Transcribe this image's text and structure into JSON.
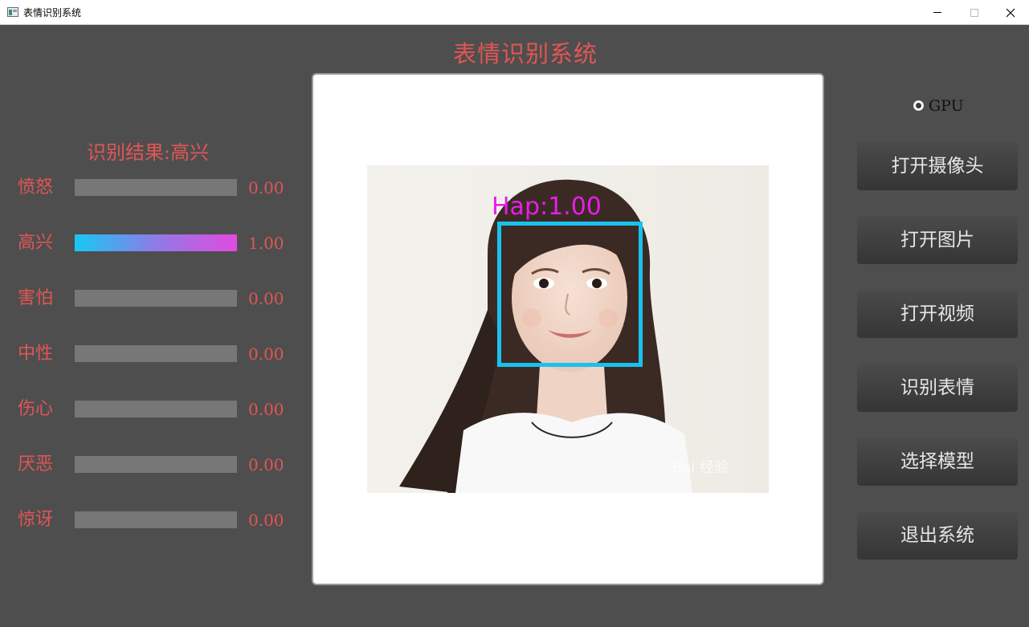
{
  "window": {
    "title": "表情识别系统",
    "controls": {
      "minimize_icon": "minimize-icon",
      "maximize_icon": "maximize-icon",
      "close_icon": "close-icon"
    }
  },
  "header": {
    "title": "表情识别系统"
  },
  "result": {
    "label": "识别结果:高兴"
  },
  "emotions": [
    {
      "name": "愤怒",
      "value": "0.00",
      "level": 0.0
    },
    {
      "name": "高兴",
      "value": "1.00",
      "level": 1.0
    },
    {
      "name": "害怕",
      "value": "0.00",
      "level": 0.0
    },
    {
      "name": "中性",
      "value": "0.00",
      "level": 0.0
    },
    {
      "name": "伤心",
      "value": "0.00",
      "level": 0.0
    },
    {
      "name": "厌恶",
      "value": "0.00",
      "level": 0.0
    },
    {
      "name": "惊讶",
      "value": "0.00",
      "level": 0.0
    }
  ],
  "image": {
    "detection_label": "Hap:1.00",
    "watermark": "Bai 经验"
  },
  "gpu": {
    "label": "GPU",
    "selected": true
  },
  "buttons": {
    "open_camera": "打开摄像头",
    "open_image": "打开图片",
    "open_video": "打开视频",
    "recognize": "识别表情",
    "select_model": "选择模型",
    "exit": "退出系统"
  },
  "colors": {
    "accent_text": "#e25555",
    "bar_empty": "#777777",
    "bar_gradient_start": "#17c8f5",
    "bar_gradient_end": "#e24ae0",
    "detection_box": "#19c2ee",
    "detection_label": "#e81ee8",
    "background": "#4e4e4e"
  }
}
